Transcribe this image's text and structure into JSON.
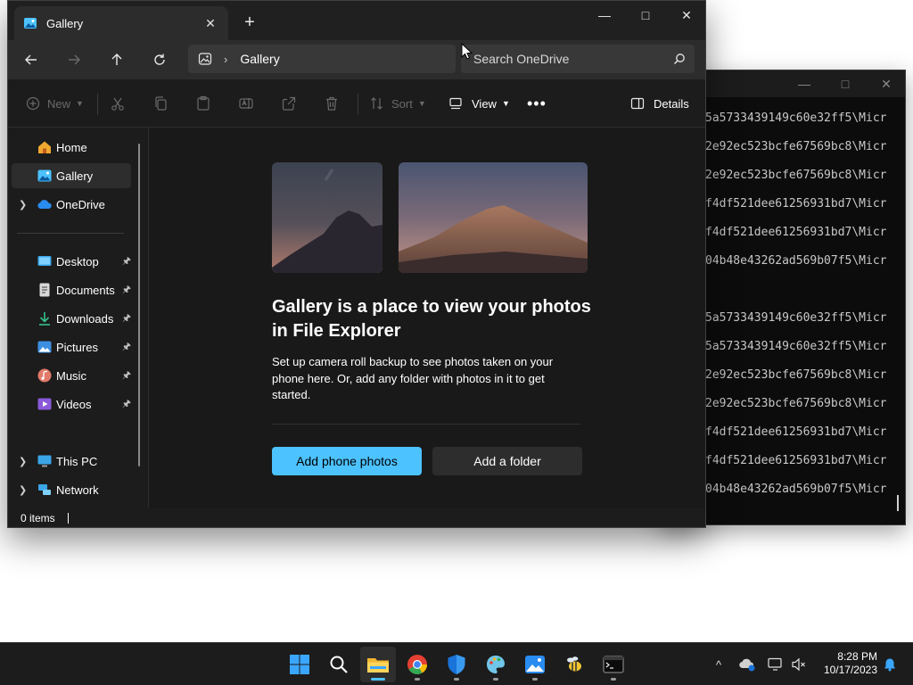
{
  "colors": {
    "accent": "#4cc2ff",
    "window_bg": "#1c1c1c",
    "toolbar_bg": "#2c2c2c",
    "terminal_bg": "#0c0c0c"
  },
  "terminal": {
    "lines": [
      "5a5733439149c60e32ff5\\Micr",
      "2e92ec523bcfe67569bc8\\Micr",
      "2e92ec523bcfe67569bc8\\Micr",
      "f4df521dee61256931bd7\\Micr",
      "f4df521dee61256931bd7\\Micr",
      "04b48e43262ad569b07f5\\Micr",
      "",
      "5a5733439149c60e32ff5\\Micr",
      "5a5733439149c60e32ff5\\Micr",
      "2e92ec523bcfe67569bc8\\Micr",
      "2e92ec523bcfe67569bc8\\Micr",
      "f4df521dee61256931bd7\\Micr",
      "f4df521dee61256931bd7\\Micr",
      "04b48e43262ad569b07f5\\Micr"
    ]
  },
  "explorer": {
    "tab": {
      "title": "Gallery",
      "icon": "gallery-icon"
    },
    "address": {
      "location": "Gallery"
    },
    "search": {
      "placeholder": "Search OneDrive"
    },
    "commands": {
      "new": "New",
      "sort": "Sort",
      "view": "View",
      "details": "Details"
    },
    "sidebar": {
      "top": [
        {
          "label": "Home",
          "icon": "home-icon",
          "chevron": false
        },
        {
          "label": "Gallery",
          "icon": "gallery-icon",
          "chevron": false,
          "selected": true
        },
        {
          "label": "OneDrive",
          "icon": "onedrive-icon",
          "chevron": true
        }
      ],
      "pinned": [
        {
          "label": "Desktop",
          "icon": "desktop-icon"
        },
        {
          "label": "Documents",
          "icon": "documents-icon"
        },
        {
          "label": "Downloads",
          "icon": "downloads-icon"
        },
        {
          "label": "Pictures",
          "icon": "pictures-icon"
        },
        {
          "label": "Music",
          "icon": "music-icon"
        },
        {
          "label": "Videos",
          "icon": "videos-icon"
        }
      ],
      "bottom": [
        {
          "label": "This PC",
          "icon": "this-pc-icon"
        },
        {
          "label": "Network",
          "icon": "network-icon"
        }
      ]
    },
    "empty_state": {
      "headline": "Gallery is a place to view your photos in File Explorer",
      "body": "Set up camera roll backup to see photos taken on your phone here. Or, add any folder with photos in it to get started.",
      "primary_button": "Add phone photos",
      "secondary_button": "Add a folder"
    },
    "status": {
      "items": "0 items"
    }
  },
  "taskbar": {
    "apps": [
      "start-icon",
      "search-icon",
      "file-explorer-icon",
      "chrome-icon",
      "defender-icon",
      "paint-icon",
      "photos-icon",
      "bee-app-icon",
      "terminal-icon"
    ],
    "clock": {
      "time": "8:28 PM",
      "date": "10/17/2023"
    }
  }
}
